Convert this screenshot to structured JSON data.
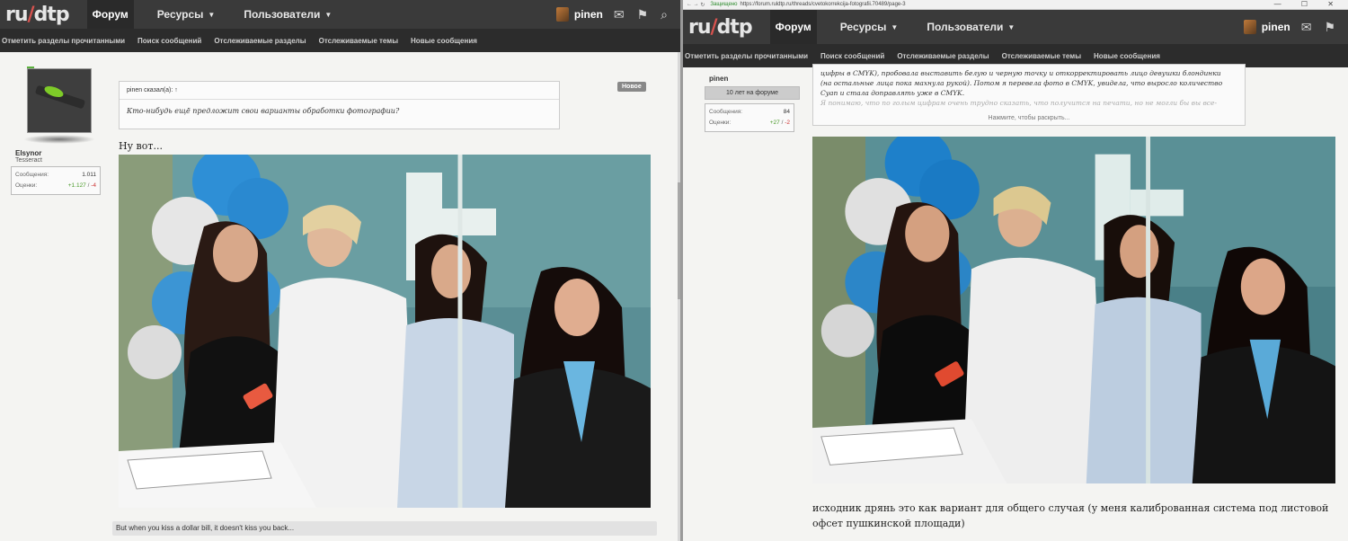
{
  "left": {
    "nav": {
      "logo": "ru/dtp",
      "tabs": [
        {
          "label": "Форум",
          "active": true,
          "caret": false
        },
        {
          "label": "Ресурсы",
          "active": false,
          "caret": true
        },
        {
          "label": "Пользователи",
          "active": false,
          "caret": true
        }
      ],
      "username": "pinen"
    },
    "subnav": [
      "Отметить разделы прочитанными",
      "Поиск сообщений",
      "Отслеживаемые разделы",
      "Отслеживаемые темы",
      "Новые сообщения"
    ],
    "post": {
      "author": "Elsynor",
      "author_title": "Tesseract",
      "messages_label": "Сообщения:",
      "messages_value": "1.011",
      "ratings_label": "Оценки:",
      "ratings_pos": "+1.127",
      "ratings_sep": " / ",
      "ratings_neg": "-4",
      "quote_head": "pinen сказал(а): ↑",
      "quote_text": "Кто-нибудь ещё предложит свои варианты обработки фотографии?",
      "new_badge": "Новое",
      "text": "Ну вот...",
      "signature": "But when you kiss a dollar bill, it doesn't kiss you back..."
    }
  },
  "right": {
    "browser": {
      "secure_label": "Защищено",
      "url": "https://forum.ruldtp.ru/threads/cvetokorrekcija-fotografii.70489/page-3",
      "controls": "— ☐ ✕"
    },
    "nav": {
      "logo": "ru/dtp",
      "tabs": [
        {
          "label": "Форум",
          "active": true,
          "caret": false
        },
        {
          "label": "Ресурсы",
          "active": false,
          "caret": true
        },
        {
          "label": "Пользователи",
          "active": false,
          "caret": true
        }
      ],
      "username": "pinen"
    },
    "subnav": [
      "Отметить разделы прочитанными",
      "Поиск сообщений",
      "Отслеживаемые разделы",
      "Отслеживаемые темы",
      "Новые сообщения"
    ],
    "post": {
      "author": "pinen",
      "badge": "10 лет на форуме",
      "messages_label": "Сообщения:",
      "messages_value": "84",
      "ratings_label": "Оценки:",
      "ratings_pos": "+27",
      "ratings_sep": " / ",
      "ratings_neg": "-2",
      "quote_lines": [
        "цифры в CMYK), пробовала выставить белую и черную точку и откорректировать лицо девушки блондинки",
        "(на остальные лица пока махнула рукой). Потом я перевела фото в CMYK, увидела, что выросло количество",
        "Cyan и стала доправлять уже в CMYK."
      ],
      "quote_faded": "Я понимаю, что по голым цифрам очень трудно сказать, что получится на печати, но не могли бы вы все-",
      "expand_label": "Нажмите, чтобы раскрыть...",
      "text": "исходник дрянь это как вариант для общего случая (у меня калиброванная система под листовой офсет пушкинской площади)"
    }
  },
  "colors": {
    "topbar": "#3a3a3a",
    "subbar": "#2c2c2c",
    "positive": "#4a9a2a",
    "negative": "#cc3333"
  }
}
